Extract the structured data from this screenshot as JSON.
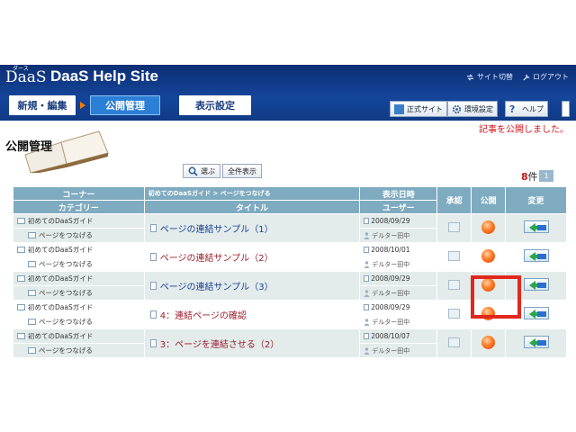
{
  "header": {
    "logo_small": "ダース",
    "logo": "DaaS",
    "site_title": "DaaS Help Site",
    "links": [
      "サイト切替",
      "ログアウト"
    ]
  },
  "tabs": [
    {
      "label": "新規・編集",
      "active": false
    },
    {
      "label": "公開管理",
      "active": true
    },
    {
      "label": "表示設定",
      "active": false
    }
  ],
  "toolbar": [
    "正式サイト",
    "環境設定",
    "ヘルプ"
  ],
  "notice": "記事を公開しました。",
  "page_title": "公開管理",
  "buttons": {
    "search": "選ぶ",
    "show_all": "全件表示"
  },
  "count": {
    "num": "8",
    "unit": "件",
    "page": "1"
  },
  "table": {
    "headers": {
      "corner": "コーナー",
      "path": "初めてのDaaSガイド > ページをつなげる",
      "datetime": "表示日時",
      "approve": "承認",
      "publish": "公開",
      "change": "変更",
      "category": "カテゴリー",
      "title": "タイトル",
      "user": "ユーザー"
    },
    "rows": [
      {
        "corner": "初めてのDaaSガイド",
        "category": "ページをつなげる",
        "title": "ページの連結サンプル（1）",
        "date": "2008/09/29",
        "user": "デルター田中",
        "color": "blue"
      },
      {
        "corner": "初めてのDaaSガイド",
        "category": "ページをつなげる",
        "title": "ページの連結サンプル（2）",
        "date": "2008/10/01",
        "user": "デルター田中",
        "color": "red"
      },
      {
        "corner": "初めてのDaaSガイド",
        "category": "ページをつなげる",
        "title": "ページの連結サンプル（3）",
        "date": "2008/09/29",
        "user": "デルター田中",
        "color": "blue"
      },
      {
        "corner": "初めてのDaaSガイド",
        "category": "ページをつなげる",
        "title": "4：連結ページの確認",
        "date": "2008/09/29",
        "user": "デルター田中",
        "color": "red"
      },
      {
        "corner": "初めてのDaaSガイド",
        "category": "ページをつなげる",
        "title": "3：ページを連結させる（2）",
        "date": "2008/10/07",
        "user": "デルター田中",
        "color": "red"
      }
    ]
  },
  "colors": {
    "header": "#15459a",
    "accent": "#2b7fd6",
    "table_head": "#7fabc0",
    "notice": "#d4141c",
    "highlight": "#e2271d"
  }
}
